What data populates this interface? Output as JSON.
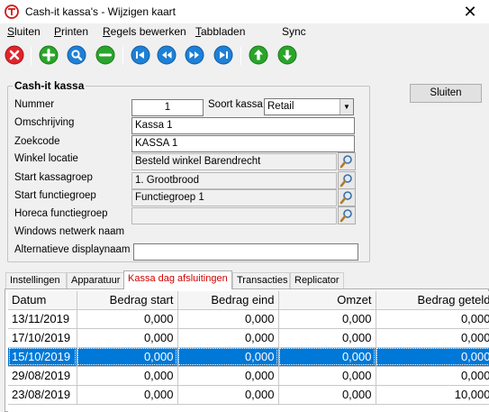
{
  "window": {
    "title": "Cash-it kassa's - Wijzigen kaart",
    "close_glyph": "✕"
  },
  "menu": [
    {
      "label": "Sluiten",
      "mnemonic": "S"
    },
    {
      "label": "Printen",
      "mnemonic": "P"
    },
    {
      "label": "Regels bewerken",
      "mnemonic": "R"
    },
    {
      "label": "Tabbladen",
      "mnemonic": "T"
    },
    {
      "label": "Sync",
      "mnemonic": ""
    }
  ],
  "toolbar": [
    {
      "name": "close-record",
      "icon": "x-icon",
      "color": "#e0242c"
    },
    {
      "name": "add-record",
      "icon": "plus-icon",
      "color": "#2aa52a"
    },
    {
      "name": "search-record",
      "icon": "magnifier-icon",
      "color": "#1e80d6"
    },
    {
      "name": "delete-record",
      "icon": "minus-icon",
      "color": "#2aa52a"
    },
    {
      "name": "first-record",
      "icon": "first-icon",
      "color": "#1e80d6"
    },
    {
      "name": "previous-record",
      "icon": "previous-icon",
      "color": "#1e80d6"
    },
    {
      "name": "next-record",
      "icon": "next-icon",
      "color": "#1e80d6"
    },
    {
      "name": "last-record",
      "icon": "last-icon",
      "color": "#1e80d6"
    },
    {
      "name": "sync-up",
      "icon": "arrow-up-icon",
      "color": "#2aa52a"
    },
    {
      "name": "sync-down",
      "icon": "arrow-down-icon",
      "color": "#2aa52a"
    }
  ],
  "form": {
    "group_title": "Cash-it kassa",
    "nummer_label": "Nummer",
    "nummer_value": "1",
    "soort_label": "Soort kassa",
    "soort_value": "Retail",
    "omschrijving_label": "Omschrijving",
    "omschrijving_value": "Kassa 1",
    "zoekcode_label": "Zoekcode",
    "zoekcode_value": "KASSA 1",
    "winkel_label": "Winkel locatie",
    "winkel_value": "Besteld winkel Barendrecht",
    "kassagroep_label": "Start kassagroep",
    "kassagroep_value": "1. Grootbrood",
    "functiegroep_label": "Start functiegroep",
    "functiegroep_value": "Functiegroep 1",
    "horeca_label": "Horeca functiegroep",
    "horeca_value": "",
    "netwerk_label": "Windows netwerk naam",
    "display_label": "Alternatieve displaynaam",
    "display_value": ""
  },
  "sluiten_button": "Sluiten",
  "tabs": [
    {
      "label": "Instellingen"
    },
    {
      "label": "Apparatuur"
    },
    {
      "label": "Kassa dag afsluitingen",
      "active": true
    },
    {
      "label": "Transacties"
    },
    {
      "label": "Replicator"
    }
  ],
  "grid": {
    "columns": [
      "Datum",
      "Bedrag start",
      "Bedrag eind",
      "Omzet",
      "Bedrag geteld"
    ],
    "rows": [
      [
        "13/11/2019",
        "0,000",
        "0,000",
        "0,000",
        "0,000"
      ],
      [
        "17/10/2019",
        "0,000",
        "0,000",
        "0,000",
        "0,000"
      ],
      [
        "15/10/2019",
        "0,000",
        "0,000",
        "0,000",
        "0,000"
      ],
      [
        "29/08/2019",
        "0,000",
        "0,000",
        "0,000",
        "0,000"
      ],
      [
        "23/08/2019",
        "0,000",
        "0,000",
        "0,000",
        "10,000"
      ]
    ],
    "selected_row": 2
  }
}
